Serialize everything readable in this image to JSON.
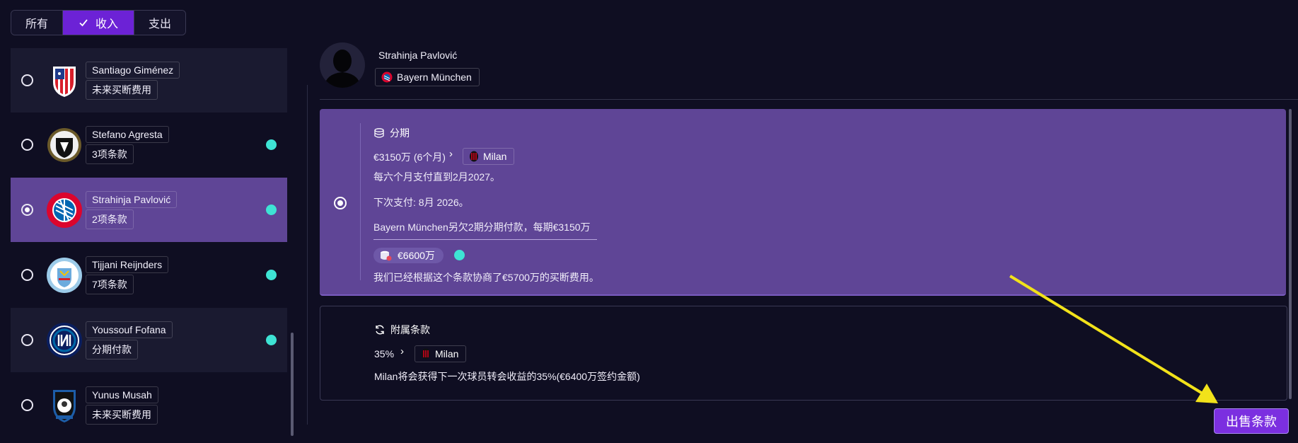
{
  "filters": [
    {
      "label": "所有",
      "active": false
    },
    {
      "label": "收入",
      "active": true
    },
    {
      "label": "支出",
      "active": false
    }
  ],
  "players": [
    {
      "name": "Santiago Giménez",
      "desc": "未来买断费用",
      "crest": "atletico-crest",
      "selected": false,
      "dot": false
    },
    {
      "name": "Stefano Agresta",
      "desc": "3项条款",
      "crest": "udinese-crest",
      "selected": false,
      "dot": true
    },
    {
      "name": "Strahinja Pavlović",
      "desc": "2项条款",
      "crest": "bayern-crest",
      "selected": true,
      "dot": true
    },
    {
      "name": "Tijjani Reijnders",
      "desc": "7项条款",
      "crest": "man-city-crest",
      "selected": false,
      "dot": true
    },
    {
      "name": "Youssouf Fofana",
      "desc": "分期付款",
      "crest": "inter-crest",
      "selected": false,
      "dot": true
    },
    {
      "name": "Yunus Musah",
      "desc": "未来买断费用",
      "crest": "atalanta-crest",
      "selected": false,
      "dot": false
    }
  ],
  "header": {
    "name": "Strahinja Pavlović",
    "club": "Bayern München"
  },
  "installment": {
    "title": "分期",
    "amount": "€3150万 (6个月)",
    "to_club": "Milan",
    "schedule": "每六个月支付直到2月2027。",
    "next_payment": "下次支付: 8月 2026。",
    "remaining": "Bayern München另欠2期分期付款，每期€3150万",
    "total": "€6600万",
    "note": "我们已经根据这个条款协商了€5700万的买断费用。"
  },
  "addon": {
    "title": "附属条款",
    "percent": "35%",
    "to_club": "Milan",
    "desc": "Milan将会获得下一次球员转会收益的35%(€6400万签约金额)"
  },
  "sell_button": "出售条款",
  "colors": {
    "accent": "#6c22d6",
    "selected_row": "#5f4596",
    "status_dot": "#3ee3d4",
    "background": "#0f0e22"
  }
}
